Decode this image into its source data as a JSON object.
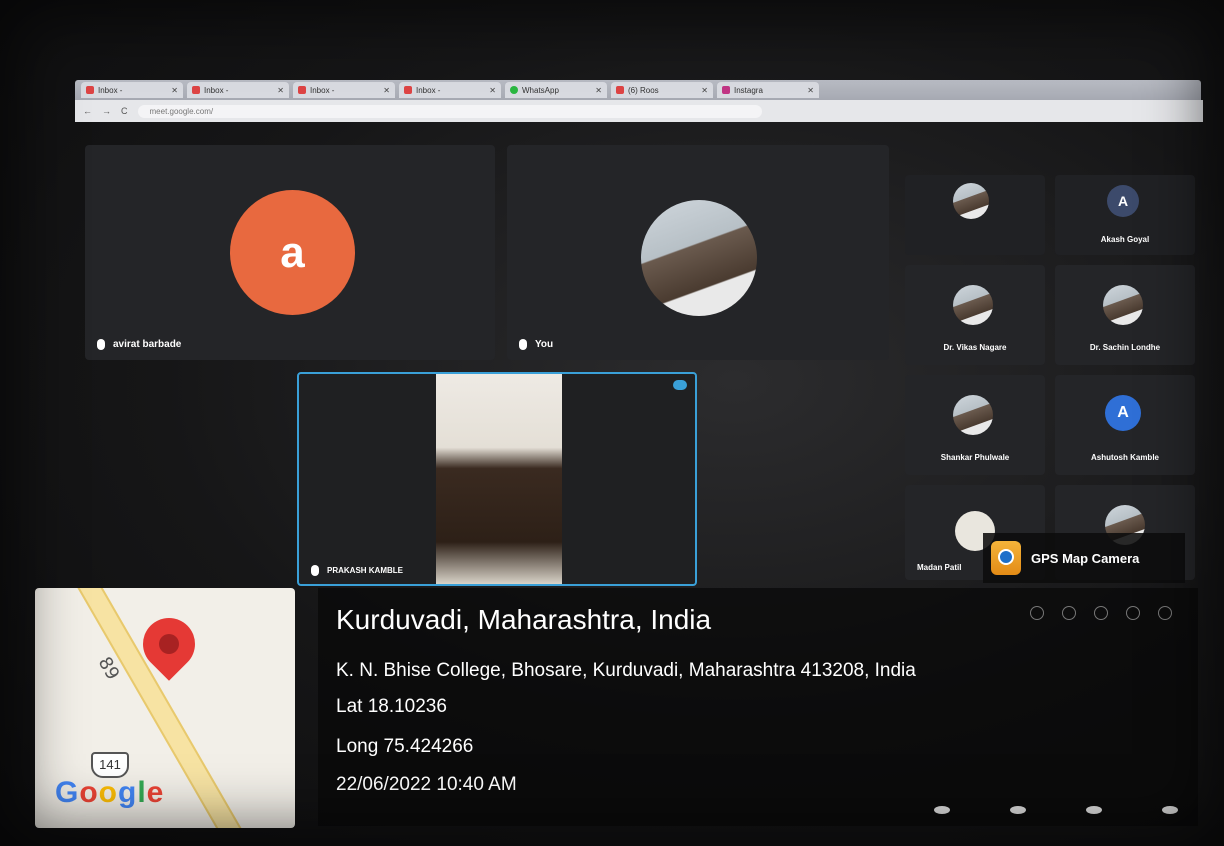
{
  "browser": {
    "tabs": [
      {
        "label": "Inbox - "
      },
      {
        "label": "Inbox - "
      },
      {
        "label": "Inbox - "
      },
      {
        "label": "Inbox - "
      },
      {
        "label": "WhatsApp"
      },
      {
        "label": "(6) Roos"
      },
      {
        "label": "Instagra"
      }
    ],
    "url": "meet.google.com/"
  },
  "meet": {
    "tiles": {
      "avirat": {
        "avatar_letter": "a",
        "avatar_color": "#e8693f",
        "name": "avirat barbade"
      },
      "you": {
        "name": "You"
      },
      "akash": {
        "avatar_letter": "A",
        "name": "Akash Goyal"
      },
      "vikas": {
        "name": "Dr. Vikas Nagare"
      },
      "sachin": {
        "name": "Dr. Sachin Londhe"
      },
      "shankar": {
        "name": "Shankar Phulwale"
      },
      "ashutosh": {
        "avatar_letter": "A",
        "avatar_color": "#2f6fd6",
        "name": "Ashutosh Kamble"
      },
      "madan": {
        "name": "Madan Patil"
      }
    },
    "pinned": {
      "name": "PRAKASH KAMBLE"
    }
  },
  "gps": {
    "app_name": "GPS Map Camera",
    "title": "Kurduvadi, Maharashtra, India",
    "address": "K. N. Bhise College, Bhosare, Kurduvadi, Maharashtra 413208, India",
    "lat": "Lat 18.10236",
    "long": "Long 75.424266",
    "datetime": "22/06/2022 10:40 AM",
    "map": {
      "road_label": "89",
      "highway_shield": "141",
      "brand": [
        "G",
        "o",
        "o",
        "g",
        "l",
        "e"
      ]
    }
  }
}
